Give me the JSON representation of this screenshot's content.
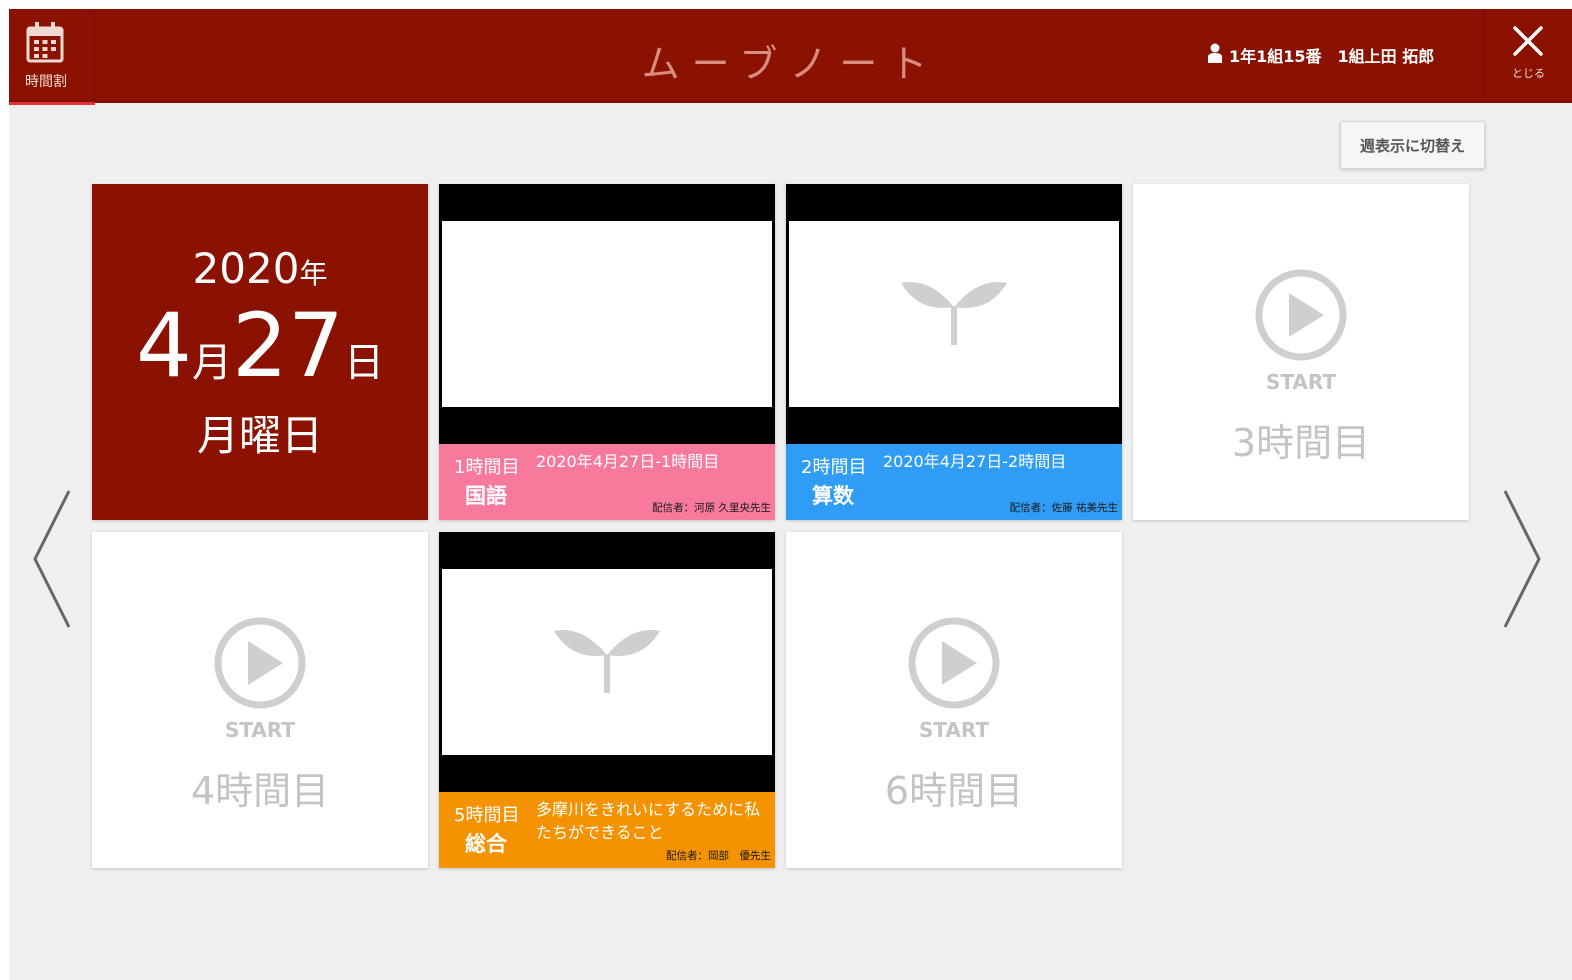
{
  "header": {
    "timetable_label": "時間割",
    "app_title": "ムーブノート",
    "user_label": "1年1組15番　1組上田 拓郎",
    "close_label": "とじる"
  },
  "toolbar": {
    "switch_view_label": "週表示に切替え"
  },
  "date": {
    "year": "2020",
    "year_unit": "年",
    "month": "4",
    "month_unit": "月",
    "day": "27",
    "day_unit": "日",
    "weekday": "月曜日"
  },
  "lessons": [
    {
      "period": "1時間目",
      "subject": "国語",
      "title": "2020年4月27日-1時間目",
      "teacher": "配信者：河原 久里央先生",
      "color": "#f77a9c",
      "thumbnail": "blank"
    },
    {
      "period": "2時間目",
      "subject": "算数",
      "title": "2020年4月27日-2時間目",
      "teacher": "配信者：佐藤 祐美先生",
      "color": "#2f9cf6",
      "thumbnail": "sprout-icon"
    },
    {
      "start": "START",
      "period": "3時間目"
    },
    {
      "start": "START",
      "period": "4時間目"
    },
    {
      "period": "5時間目",
      "subject": "総合",
      "title": "多摩川をきれいにするために私たちができること",
      "teacher": "配信者：岡部　優先生",
      "color": "#f59200",
      "thumbnail": "sprout-icon"
    },
    {
      "start": "START",
      "period": "6時間目"
    }
  ],
  "colors": {
    "header_bg": "#8b1200",
    "page_bg": "#efefef",
    "inactive_text": "#c4c4c4"
  },
  "icons": [
    "calendar-icon",
    "user-icon",
    "close-icon",
    "sprout-icon",
    "play-icon",
    "chevron-left-icon",
    "chevron-right-icon"
  ]
}
